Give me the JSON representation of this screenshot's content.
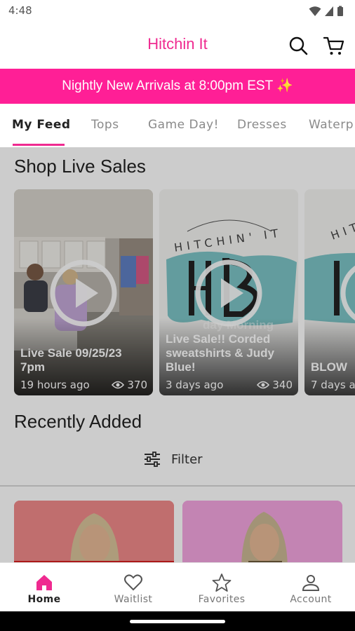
{
  "status_bar": {
    "time": "4:48"
  },
  "header": {
    "title": "Hitchin It"
  },
  "promo": {
    "text": "Nightly New Arrivals at 8:00pm EST ✨"
  },
  "tabs": [
    "My Feed",
    "Tops",
    "Game Day!",
    "Dresses",
    "Waterp"
  ],
  "active_tab": "My Feed",
  "live_sales": {
    "title": "Shop Live Sales",
    "cards": [
      {
        "title": "Live Sale 09/25/23 7pm",
        "time": "19 hours ago",
        "views": "370"
      },
      {
        "title": "Live Sale!! Corded sweatshirts & Judy Blue!",
        "faded_text": "day Morning",
        "time": "3 days ago",
        "views": "340"
      },
      {
        "title": "BLOW",
        "time": "7 days a",
        "views": ""
      }
    ],
    "logo_lettering": "HITCHIN' IT BOUTIQUE"
  },
  "recently_added": {
    "title": "Recently Added",
    "filter_label": "Filter"
  },
  "bottom_nav": [
    {
      "label": "Home",
      "icon": "home-icon",
      "active": true
    },
    {
      "label": "Waitlist",
      "icon": "heart-icon",
      "active": false
    },
    {
      "label": "Favorites",
      "icon": "star-icon",
      "active": false
    },
    {
      "label": "Account",
      "icon": "person-icon",
      "active": false
    }
  ],
  "colors": {
    "brand_pink": "#ef2a90",
    "banner_pink": "#ff1f96",
    "logo_teal": "#7cc4c6"
  }
}
